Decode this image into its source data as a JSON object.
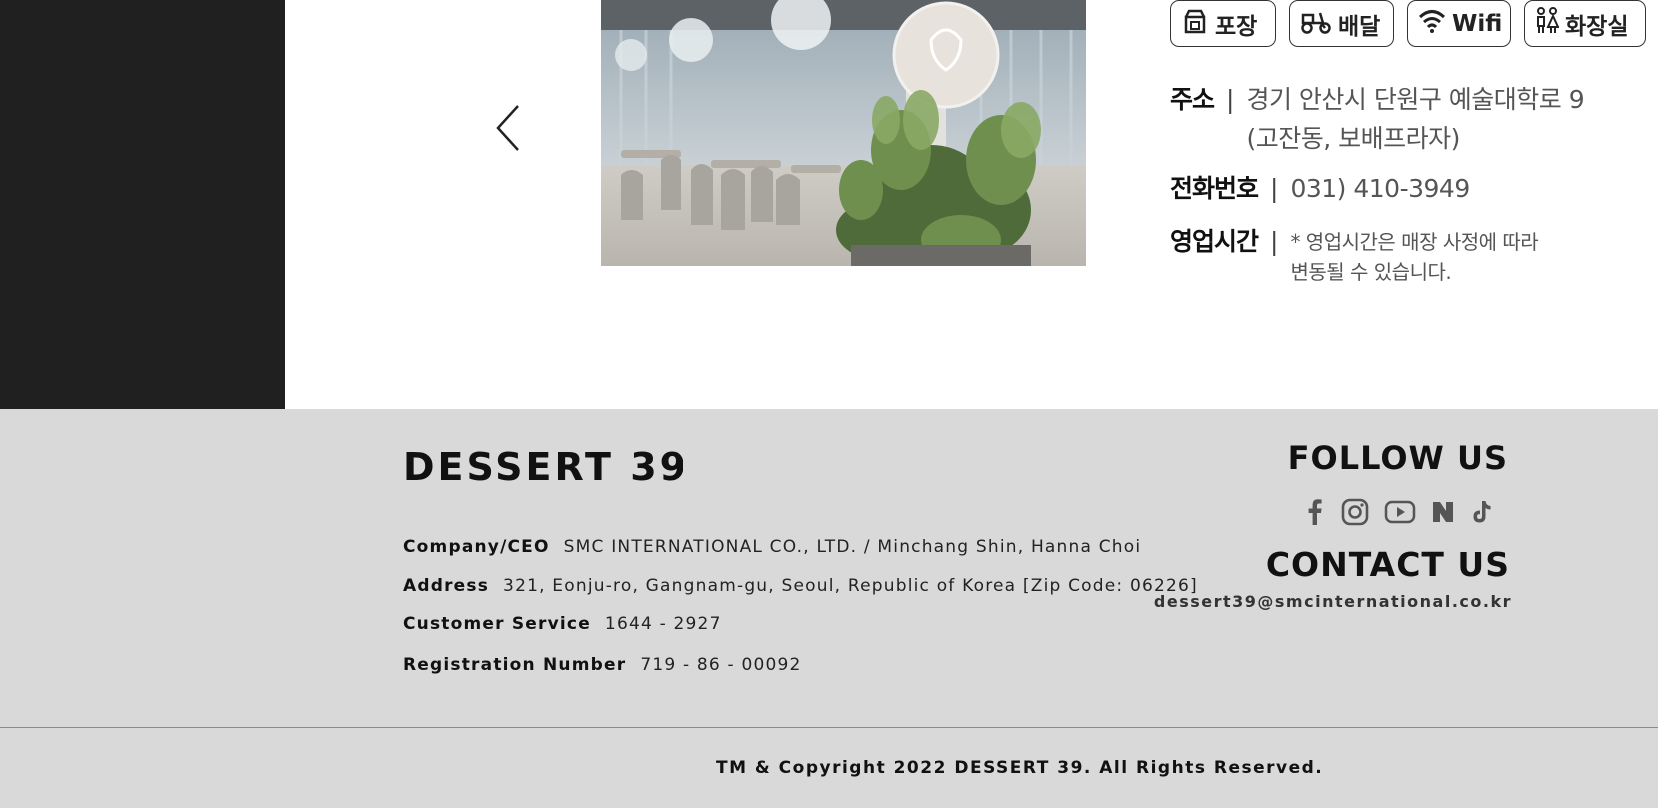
{
  "amenities": [
    {
      "label": "포장",
      "icon": "takeout-icon"
    },
    {
      "label": "배달",
      "icon": "delivery-scooter-icon"
    },
    {
      "label": "Wifi",
      "icon": "wifi-icon"
    },
    {
      "label": "화장실",
      "icon": "restroom-icon"
    }
  ],
  "store_info": {
    "address_label": "주소",
    "address_line1": "경기 안산시 단원구 예술대학로 9",
    "address_line2": "(고잔동, 보배프라자)",
    "phone_label": "전화번호",
    "phone": "031) 410-3949",
    "hours_label": "영업시간",
    "hours_note_line1": "* 영업시간은 매장 사정에 따라",
    "hours_note_line2": "변동될 수 있습니다.",
    "separator": "|"
  },
  "footer": {
    "logo_text": "DESSERT 39",
    "company_label": "Company/CEO",
    "company_value": "SMC INTERNATIONAL CO., LTD. / Minchang Shin, Hanna Choi",
    "address_label": "Address",
    "address_value": "321, Eonju-ro, Gangnam-gu, Seoul, Republic of Korea [Zip Code: 06226]",
    "service_label": "Customer Service",
    "service_value": "1644 - 2927",
    "registration_label": "Registration Number",
    "registration_value": "719 - 86 - 00092",
    "follow_us": "FOLLOW US",
    "contact_us": "CONTACT US",
    "email": "dessert39@smcinternational.co.kr",
    "copyright": "TM & Copyright 2022 DESSERT 39. All Rights Reserved."
  },
  "socials": [
    "facebook-icon",
    "instagram-icon",
    "youtube-icon",
    "naver-blog-icon",
    "tiktok-icon"
  ],
  "colors": {
    "dark_panel": "#202020",
    "footer_bg": "#d9d9d9",
    "text_dark": "#111111",
    "icon_gray": "#555555"
  }
}
